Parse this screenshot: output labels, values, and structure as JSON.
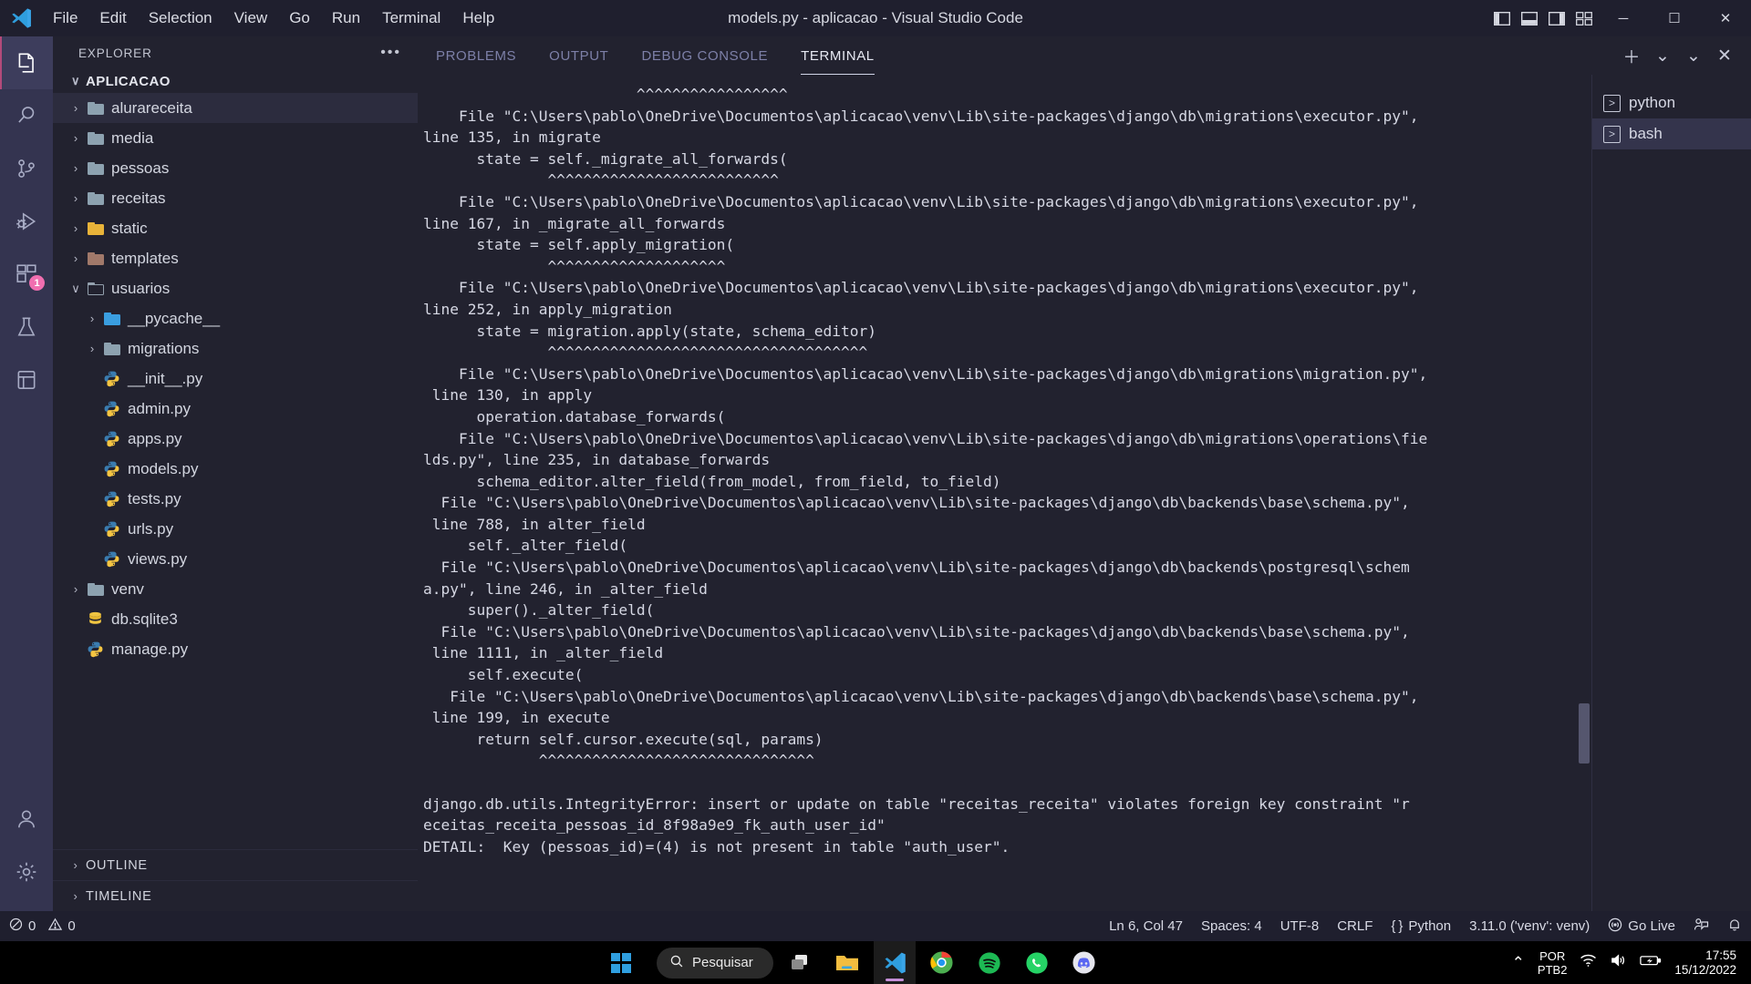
{
  "titlebar": {
    "menus": [
      "File",
      "Edit",
      "Selection",
      "View",
      "Go",
      "Run",
      "Terminal",
      "Help"
    ],
    "window_title": "models.py - aplicacao - Visual Studio Code",
    "minimize": "─",
    "maximize": "☐",
    "close": "✕"
  },
  "activitybar": {
    "items": [
      {
        "name": "explorer",
        "icon": "files-icon",
        "active": true,
        "badge": ""
      },
      {
        "name": "search",
        "icon": "search-icon",
        "active": false,
        "badge": ""
      },
      {
        "name": "source-control",
        "icon": "source-control-icon",
        "active": false,
        "badge": ""
      },
      {
        "name": "run-debug",
        "icon": "run-debug-icon",
        "active": false,
        "badge": ""
      },
      {
        "name": "extensions",
        "icon": "extensions-icon",
        "active": false,
        "badge": "1"
      },
      {
        "name": "testing",
        "icon": "beaker-icon",
        "active": false,
        "badge": ""
      },
      {
        "name": "database",
        "icon": "database-icon",
        "active": false,
        "badge": ""
      }
    ],
    "bottom": [
      {
        "name": "accounts",
        "icon": "account-icon"
      },
      {
        "name": "settings",
        "icon": "gear-icon"
      }
    ]
  },
  "sidebar": {
    "header": "EXPLORER",
    "more_actions": "•••",
    "root": "APLICACAO",
    "tree": [
      {
        "label": "alurareceita",
        "type": "folder",
        "color": "#8da2b0",
        "indent": 1,
        "twisty": "›",
        "selected": true
      },
      {
        "label": "media",
        "type": "folder",
        "color": "#8da2b0",
        "indent": 1,
        "twisty": "›",
        "selected": false
      },
      {
        "label": "pessoas",
        "type": "folder",
        "color": "#8da2b0",
        "indent": 1,
        "twisty": "›",
        "selected": false
      },
      {
        "label": "receitas",
        "type": "folder",
        "color": "#8da2b0",
        "indent": 1,
        "twisty": "›",
        "selected": false
      },
      {
        "label": "static",
        "type": "folder",
        "color": "#e8b339",
        "indent": 1,
        "twisty": "›",
        "selected": false
      },
      {
        "label": "templates",
        "type": "folder",
        "color": "#a1796a",
        "indent": 1,
        "twisty": "›",
        "selected": false
      },
      {
        "label": "usuarios",
        "type": "folder-open",
        "color": "#93a0ad",
        "indent": 1,
        "twisty": "∨",
        "selected": false
      },
      {
        "label": "__pycache__",
        "type": "folder",
        "color": "#3a9ee0",
        "indent": 2,
        "twisty": "›",
        "selected": false
      },
      {
        "label": "migrations",
        "type": "folder",
        "color": "#8da2b0",
        "indent": 2,
        "twisty": "›",
        "selected": false
      },
      {
        "label": "__init__.py",
        "type": "python",
        "color": "#3a7cb0",
        "indent": 2,
        "twisty": "",
        "selected": false
      },
      {
        "label": "admin.py",
        "type": "python",
        "color": "#3a7cb0",
        "indent": 2,
        "twisty": "",
        "selected": false
      },
      {
        "label": "apps.py",
        "type": "python",
        "color": "#3a7cb0",
        "indent": 2,
        "twisty": "",
        "selected": false
      },
      {
        "label": "models.py",
        "type": "python",
        "color": "#3a7cb0",
        "indent": 2,
        "twisty": "",
        "selected": false
      },
      {
        "label": "tests.py",
        "type": "python",
        "color": "#3a7cb0",
        "indent": 2,
        "twisty": "",
        "selected": false
      },
      {
        "label": "urls.py",
        "type": "python",
        "color": "#3a7cb0",
        "indent": 2,
        "twisty": "",
        "selected": false
      },
      {
        "label": "views.py",
        "type": "python",
        "color": "#3a7cb0",
        "indent": 2,
        "twisty": "",
        "selected": false
      },
      {
        "label": "venv",
        "type": "folder",
        "color": "#8da2b0",
        "indent": 1,
        "twisty": "›",
        "selected": false
      },
      {
        "label": "db.sqlite3",
        "type": "database",
        "color": "#e8c547",
        "indent": 1,
        "twisty": "",
        "selected": false
      },
      {
        "label": "manage.py",
        "type": "python",
        "color": "#3a7cb0",
        "indent": 1,
        "twisty": "",
        "selected": false
      }
    ],
    "sections": [
      {
        "label": "OUTLINE",
        "twisty": "›"
      },
      {
        "label": "TIMELINE",
        "twisty": "›"
      }
    ]
  },
  "panel": {
    "tabs": [
      {
        "label": "PROBLEMS",
        "active": false
      },
      {
        "label": "OUTPUT",
        "active": false
      },
      {
        "label": "DEBUG CONSOLE",
        "active": false
      },
      {
        "label": "TERMINAL",
        "active": true
      }
    ],
    "actions": [
      {
        "name": "new-terminal-button",
        "glyph": "＋"
      },
      {
        "name": "terminal-dropdown-button",
        "glyph": "⌄"
      },
      {
        "name": "panel-maximize-button",
        "glyph": "⌄"
      },
      {
        "name": "panel-close-button",
        "glyph": "✕"
      }
    ],
    "terminal_list": [
      {
        "label": "python",
        "selected": false
      },
      {
        "label": "bash",
        "selected": true
      }
    ],
    "terminal_output": "                        ^^^^^^^^^^^^^^^^^\n    File \"C:\\Users\\pablo\\OneDrive\\Documentos\\aplicacao\\venv\\Lib\\site-packages\\django\\db\\migrations\\executor.py\",\nline 135, in migrate\n      state = self._migrate_all_forwards(\n              ^^^^^^^^^^^^^^^^^^^^^^^^^^\n    File \"C:\\Users\\pablo\\OneDrive\\Documentos\\aplicacao\\venv\\Lib\\site-packages\\django\\db\\migrations\\executor.py\",\nline 167, in _migrate_all_forwards\n      state = self.apply_migration(\n              ^^^^^^^^^^^^^^^^^^^^\n    File \"C:\\Users\\pablo\\OneDrive\\Documentos\\aplicacao\\venv\\Lib\\site-packages\\django\\db\\migrations\\executor.py\",\nline 252, in apply_migration\n      state = migration.apply(state, schema_editor)\n              ^^^^^^^^^^^^^^^^^^^^^^^^^^^^^^^^^^^^\n    File \"C:\\Users\\pablo\\OneDrive\\Documentos\\aplicacao\\venv\\Lib\\site-packages\\django\\db\\migrations\\migration.py\",\n line 130, in apply\n      operation.database_forwards(\n    File \"C:\\Users\\pablo\\OneDrive\\Documentos\\aplicacao\\venv\\Lib\\site-packages\\django\\db\\migrations\\operations\\fie\nlds.py\", line 235, in database_forwards\n      schema_editor.alter_field(from_model, from_field, to_field)\n  File \"C:\\Users\\pablo\\OneDrive\\Documentos\\aplicacao\\venv\\Lib\\site-packages\\django\\db\\backends\\base\\schema.py\",\n line 788, in alter_field\n     self._alter_field(\n  File \"C:\\Users\\pablo\\OneDrive\\Documentos\\aplicacao\\venv\\Lib\\site-packages\\django\\db\\backends\\postgresql\\schem\na.py\", line 246, in _alter_field\n     super()._alter_field(\n  File \"C:\\Users\\pablo\\OneDrive\\Documentos\\aplicacao\\venv\\Lib\\site-packages\\django\\db\\backends\\base\\schema.py\",\n line 1111, in _alter_field\n     self.execute(\n   File \"C:\\Users\\pablo\\OneDrive\\Documentos\\aplicacao\\venv\\Lib\\site-packages\\django\\db\\backends\\base\\schema.py\",\n line 199, in execute\n      return self.cursor.execute(sql, params)\n             ^^^^^^^^^^^^^^^^^^^^^^^^^^^^^^^\n\ndjango.db.utils.IntegrityError: insert or update on table \"receitas_receita\" violates foreign key constraint \"r\neceitas_receita_pessoas_id_8f98a9e9_fk_auth_user_id\"\nDETAIL:  Key (pessoas_id)=(4) is not present in table \"auth_user\"."
  },
  "statusbar": {
    "errors": "0",
    "warnings": "0",
    "cursor": "Ln 6, Col 47",
    "spaces": "Spaces: 4",
    "encoding": "UTF-8",
    "eol": "CRLF",
    "language": "Python",
    "interpreter": "3.11.0 ('venv': venv)",
    "golive": "Go Live",
    "brace_icon": "{ }",
    "error_icon": "ⓧ",
    "warning_icon": "⚠",
    "broadcast_icon": "Ⓦ",
    "feedback_icon": "feedback-icon",
    "bell_icon": "ὑ4"
  },
  "taskbar": {
    "search_placeholder": "Pesquisar",
    "apps": [
      {
        "name": "task-view",
        "active": false
      },
      {
        "name": "file-explorer",
        "active": false
      },
      {
        "name": "vscode",
        "active": true
      },
      {
        "name": "chrome",
        "active": false
      },
      {
        "name": "spotify",
        "active": false
      },
      {
        "name": "whatsapp",
        "active": false
      },
      {
        "name": "discord",
        "active": false
      }
    ],
    "tray": {
      "chevron": "⌃",
      "lang_line1": "POR",
      "lang_line2": "PTB2",
      "time": "17:55",
      "date": "15/12/2022"
    }
  }
}
